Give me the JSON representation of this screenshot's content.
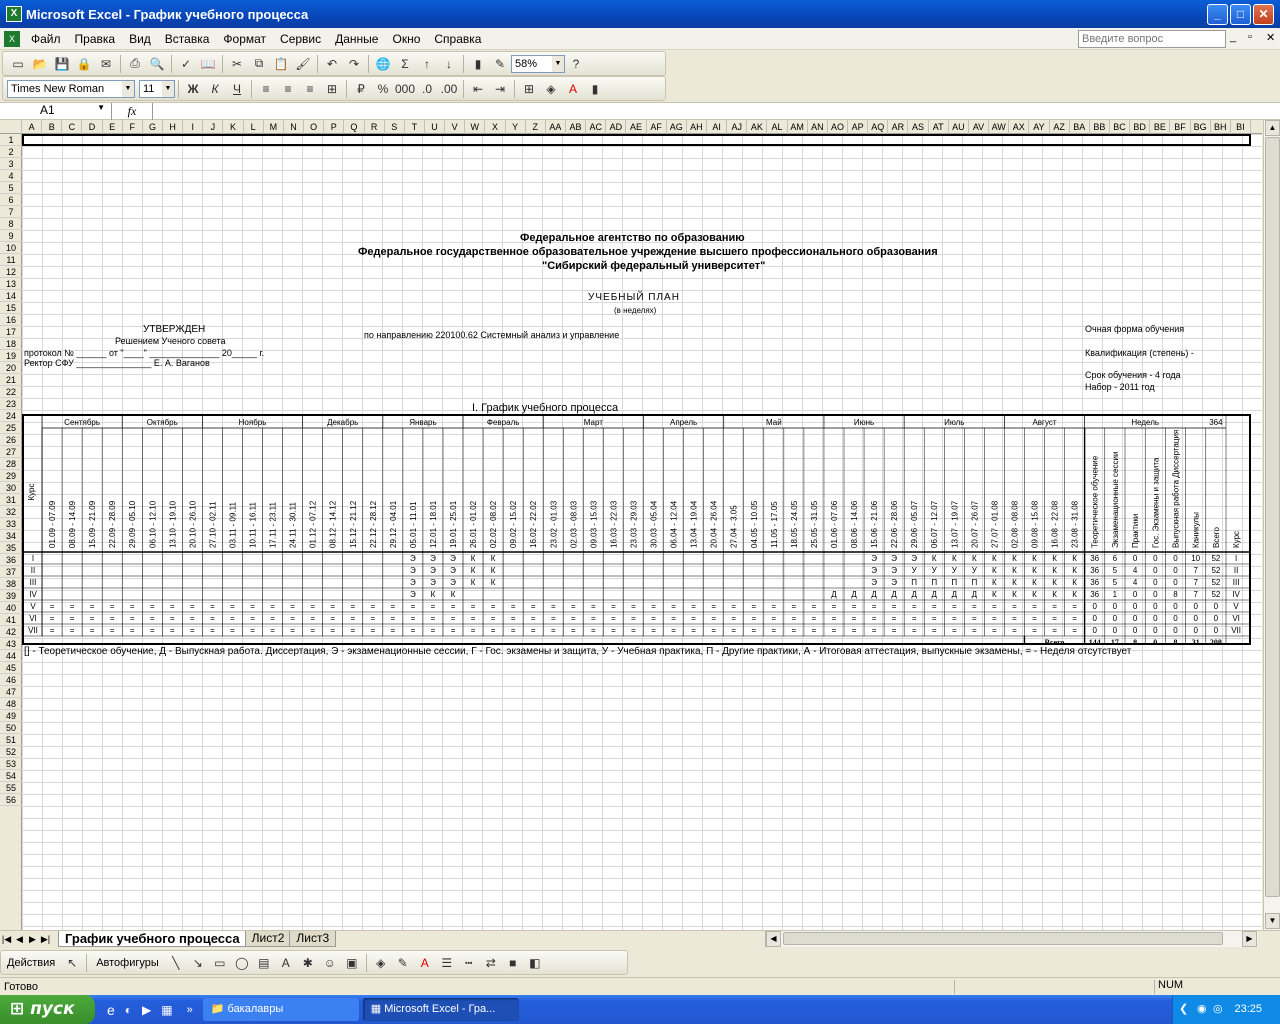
{
  "window": {
    "title": "Microsoft Excel - График учебного процесса",
    "minimize": "_",
    "maximize": "□",
    "close": "✕"
  },
  "menu": {
    "items": [
      "Файл",
      "Правка",
      "Вид",
      "Вставка",
      "Формат",
      "Сервис",
      "Данные",
      "Окно",
      "Справка"
    ],
    "help_placeholder": "Введите вопрос"
  },
  "toolbar": {
    "zoom": "58%",
    "font_name": "Times New Roman",
    "font_size": "11"
  },
  "formula": {
    "name_box": "A1",
    "fx": "fx"
  },
  "columns": [
    "A",
    "B",
    "C",
    "D",
    "E",
    "F",
    "G",
    "H",
    "I",
    "J",
    "K",
    "L",
    "M",
    "N",
    "O",
    "P",
    "Q",
    "R",
    "S",
    "T",
    "U",
    "V",
    "W",
    "X",
    "Y",
    "Z",
    "AA",
    "AB",
    "AC",
    "AD",
    "AE",
    "AF",
    "AG",
    "AH",
    "AI",
    "AJ",
    "AK",
    "AL",
    "AM",
    "AN",
    "AO",
    "AP",
    "AQ",
    "AR",
    "AS",
    "AT",
    "AU",
    "AV",
    "AW",
    "AX",
    "AY",
    "AZ",
    "BA",
    "BB",
    "BC",
    "BD",
    "BE",
    "BF",
    "BG",
    "BH",
    "BI"
  ],
  "rows": [
    "1",
    "2",
    "3",
    "4",
    "5",
    "6",
    "7",
    "8",
    "9",
    "10",
    "11",
    "12",
    "13",
    "14",
    "15",
    "16",
    "17",
    "18",
    "19",
    "20",
    "21",
    "22",
    "23",
    "24",
    "25",
    "26",
    "27",
    "28",
    "29",
    "30",
    "31",
    "32",
    "33",
    "34",
    "35",
    "36",
    "37",
    "38",
    "39",
    "40",
    "41",
    "42",
    "43",
    "44",
    "45",
    "46",
    "47",
    "48",
    "49",
    "50",
    "51",
    "52",
    "53",
    "54",
    "55",
    "56"
  ],
  "header": {
    "agency": "Федеральное агентство по образованию",
    "institution": "Федеральное государственное образовательное учреждение высшего профессионального образования",
    "university": "\"Сибирский федеральный университет\"",
    "plan_title": "УЧЕБНЫЙ ПЛАН",
    "plan_subtitle": "(в неделях)"
  },
  "approval": {
    "approved": "УТВЕРЖДЕН",
    "decision": "Решением Ученого совета",
    "protocol": "протокол № ______  от \"____\" ______________ 20_____ г.",
    "rector": "Ректор СФУ _______________ Е. А. Ваганов"
  },
  "direction": "по направлению 220100.62 Системный анализ и управление",
  "info": {
    "form": "Очная форма обучения",
    "qualification": "Квалификация (степень) -",
    "duration": "Срок обучения - 4 года",
    "intake": "Набор - 2011 год"
  },
  "schedule": {
    "section_title": "I. График учебного процесса",
    "course_label": "Курс",
    "months": [
      "Сентябрь",
      "Октябрь",
      "Ноябрь",
      "Декабрь",
      "Январь",
      "Февраль",
      "Март",
      "Апрель",
      "Май",
      "Июнь",
      "Июль",
      "Август"
    ],
    "weeks_label": "Недель",
    "weeks_total": "364",
    "dates": [
      "01.09 - 07.09",
      "08.09 - 14.09",
      "15.09 - 21.09",
      "22.09 - 28.09",
      "29.09 - 05.10",
      "06.10 - 12.10",
      "13.10 - 19.10",
      "20.10 - 26.10",
      "27.10 - 02.11",
      "03.11 - 09.11",
      "10.11 - 16.11",
      "17.11 - 23.11",
      "24.11 - 30.11",
      "01.12 - 07.12",
      "08.12 - 14.12",
      "15.12 - 21.12",
      "22.12 - 28.12",
      "29.12 - 04.01",
      "05.01 - 11.01",
      "12.01 - 18.01",
      "19.01 - 25.01",
      "26.01 - 01.02",
      "02.02 - 08.02",
      "09.02 - 15.02",
      "16.02 - 22.02",
      "23.02 - 01.03",
      "02.03 - 08.03",
      "09.03 - 15.03",
      "16.03 - 22.03",
      "23.03 - 29.03",
      "30.03 - 05.04",
      "06.04 - 12.04",
      "13.04 - 19.04",
      "20.04 - 26.04",
      "27.04 - 3.05",
      "04.05 - 10.05",
      "11.05 - 17.05",
      "18.05 - 24.05",
      "25.05 - 31.05",
      "01.06 - 07.06",
      "08.06 - 14.06",
      "15.06 - 21.06",
      "22.06 - 28.06",
      "29.06 - 05.07",
      "06.07 - 12.07",
      "13.07 - 19.07",
      "20.07 - 26.07",
      "27.07 - 01.08",
      "02.08 - 08.08",
      "09.08 - 15.08",
      "16.08 - 22.08",
      "23.08 - 31.08"
    ],
    "summary_headers": [
      "Теоретическое обучение",
      "Экзаменационные сессии",
      "Практики",
      "Гос. Экзамены и защита",
      "Выпускная работа Диссертация",
      "Каникулы",
      "Всего",
      "Курс"
    ],
    "rows": [
      {
        "course": "I",
        "weeks": [
          "",
          "",
          "",
          "",
          "",
          "",
          "",
          "",
          "",
          "",
          "",
          "",
          "",
          "",
          "",
          "",
          "",
          "",
          "Э",
          "Э",
          "Э",
          "К",
          "К",
          "",
          "",
          "",
          "",
          "",
          "",
          "",
          "",
          "",
          "",
          "",
          "",
          "",
          "",
          "",
          "",
          "",
          "",
          "Э",
          "Э",
          "Э",
          "К",
          "К",
          "К",
          "К",
          "К",
          "К",
          "К",
          "К"
        ],
        "summary": [
          "36",
          "6",
          "0",
          "0",
          "0",
          "10",
          "52",
          "I"
        ]
      },
      {
        "course": "II",
        "weeks": [
          "",
          "",
          "",
          "",
          "",
          "",
          "",
          "",
          "",
          "",
          "",
          "",
          "",
          "",
          "",
          "",
          "",
          "",
          "Э",
          "Э",
          "Э",
          "К",
          "К",
          "",
          "",
          "",
          "",
          "",
          "",
          "",
          "",
          "",
          "",
          "",
          "",
          "",
          "",
          "",
          "",
          "",
          "",
          "Э",
          "Э",
          "У",
          "У",
          "У",
          "У",
          "К",
          "К",
          "К",
          "К",
          "К"
        ],
        "summary": [
          "36",
          "5",
          "4",
          "0",
          "0",
          "7",
          "52",
          "II"
        ]
      },
      {
        "course": "III",
        "weeks": [
          "",
          "",
          "",
          "",
          "",
          "",
          "",
          "",
          "",
          "",
          "",
          "",
          "",
          "",
          "",
          "",
          "",
          "",
          "Э",
          "Э",
          "Э",
          "К",
          "К",
          "",
          "",
          "",
          "",
          "",
          "",
          "",
          "",
          "",
          "",
          "",
          "",
          "",
          "",
          "",
          "",
          "",
          "",
          "Э",
          "Э",
          "П",
          "П",
          "П",
          "П",
          "К",
          "К",
          "К",
          "К",
          "К"
        ],
        "summary": [
          "36",
          "5",
          "4",
          "0",
          "0",
          "7",
          "52",
          "III"
        ]
      },
      {
        "course": "IV",
        "weeks": [
          "",
          "",
          "",
          "",
          "",
          "",
          "",
          "",
          "",
          "",
          "",
          "",
          "",
          "",
          "",
          "",
          "",
          "",
          "Э",
          "К",
          "К",
          "",
          "",
          "",
          "",
          "",
          "",
          "",
          "",
          "",
          "",
          "",
          "",
          "",
          "",
          "",
          "",
          "",
          "",
          "Д",
          "Д",
          "Д",
          "Д",
          "Д",
          "Д",
          "Д",
          "Д",
          "К",
          "К",
          "К",
          "К",
          "К"
        ],
        "summary": [
          "36",
          "1",
          "0",
          "0",
          "8",
          "7",
          "52",
          "IV"
        ]
      },
      {
        "course": "V",
        "weeks": [
          "=",
          "=",
          "=",
          "=",
          "=",
          "=",
          "=",
          "=",
          "=",
          "=",
          "=",
          "=",
          "=",
          "=",
          "=",
          "=",
          "=",
          "=",
          "=",
          "=",
          "=",
          "=",
          "=",
          "=",
          "=",
          "=",
          "=",
          "=",
          "=",
          "=",
          "=",
          "=",
          "=",
          "=",
          "=",
          "=",
          "=",
          "=",
          "=",
          "=",
          "=",
          "=",
          "=",
          "=",
          "=",
          "=",
          "=",
          "=",
          "=",
          "=",
          "=",
          "="
        ],
        "summary": [
          "0",
          "0",
          "0",
          "0",
          "0",
          "0",
          "0",
          "V"
        ]
      },
      {
        "course": "VI",
        "weeks": [
          "=",
          "=",
          "=",
          "=",
          "=",
          "=",
          "=",
          "=",
          "=",
          "=",
          "=",
          "=",
          "=",
          "=",
          "=",
          "=",
          "=",
          "=",
          "=",
          "=",
          "=",
          "=",
          "=",
          "=",
          "=",
          "=",
          "=",
          "=",
          "=",
          "=",
          "=",
          "=",
          "=",
          "=",
          "=",
          "=",
          "=",
          "=",
          "=",
          "=",
          "=",
          "=",
          "=",
          "=",
          "=",
          "=",
          "=",
          "=",
          "=",
          "=",
          "=",
          "="
        ],
        "summary": [
          "0",
          "0",
          "0",
          "0",
          "0",
          "0",
          "0",
          "VI"
        ]
      },
      {
        "course": "VII",
        "weeks": [
          "=",
          "=",
          "=",
          "=",
          "=",
          "=",
          "=",
          "=",
          "=",
          "=",
          "=",
          "=",
          "=",
          "=",
          "=",
          "=",
          "=",
          "=",
          "=",
          "=",
          "=",
          "=",
          "=",
          "=",
          "=",
          "=",
          "=",
          "=",
          "=",
          "=",
          "=",
          "=",
          "=",
          "=",
          "=",
          "=",
          "=",
          "=",
          "=",
          "=",
          "=",
          "=",
          "=",
          "=",
          "=",
          "=",
          "=",
          "=",
          "=",
          "=",
          "=",
          "="
        ],
        "summary": [
          "0",
          "0",
          "0",
          "0",
          "0",
          "0",
          "0",
          "VII"
        ]
      }
    ],
    "total_label": "Всего",
    "totals": [
      "144",
      "17",
      "8",
      "0",
      "8",
      "31",
      "208"
    ],
    "legend": "[] - Теоретическое обучение, Д - Выпускная работа. Диссертация, Э - экзаменационные сессии, Г - Гос. экзамены и защита, У - Учебная практика, П - Другие практики, А - Итоговая аттестация, выпускные экзамены, = - Неделя отсутствует"
  },
  "sheet_tabs": [
    "График учебного процесса",
    "Лист2",
    "Лист3"
  ],
  "drawing": {
    "actions": "Действия",
    "autoshapes": "Автофигуры"
  },
  "status": {
    "ready": "Готово",
    "num": "NUM"
  },
  "taskbar": {
    "start": "пуск",
    "folder_task": "бакалавры",
    "excel_task": "Microsoft Excel - Гра...",
    "clock": "23:25"
  }
}
